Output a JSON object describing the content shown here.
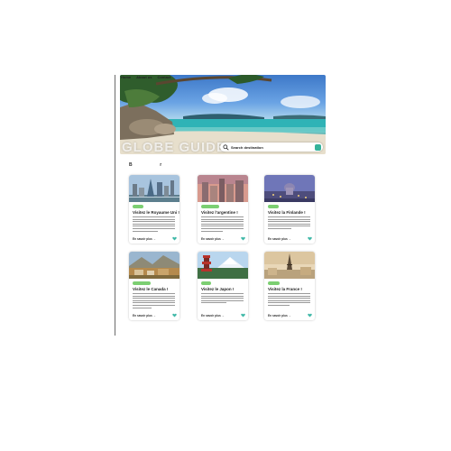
{
  "nav": {
    "items": [
      "Home",
      "About us",
      "Contact"
    ]
  },
  "hero": {
    "brand": "GLOBE GUIDE",
    "search_placeholder": "Search destination"
  },
  "section": {
    "title_start": "B",
    "title_end": "r"
  },
  "cards": [
    {
      "badge": "",
      "title": "Visitez le Royaume Uni !",
      "more": "En savoir plus"
    },
    {
      "badge": "",
      "title": "Visitez l'argentine !",
      "more": "En savoir plus"
    },
    {
      "badge": "",
      "title": "Visitez la Finlande !",
      "more": "En savoir plus"
    },
    {
      "badge": "",
      "title": "Visitez le Canada !",
      "more": "En savoir plus"
    },
    {
      "badge": "",
      "title": "Visitez le Japon !",
      "more": "En savoir plus"
    },
    {
      "badge": "",
      "title": "Visitez la France !",
      "more": "En savoir plus"
    }
  ],
  "colors": {
    "accent": "#35b39a",
    "badge": "#7ccf72",
    "heart": "#3fb8a7"
  }
}
